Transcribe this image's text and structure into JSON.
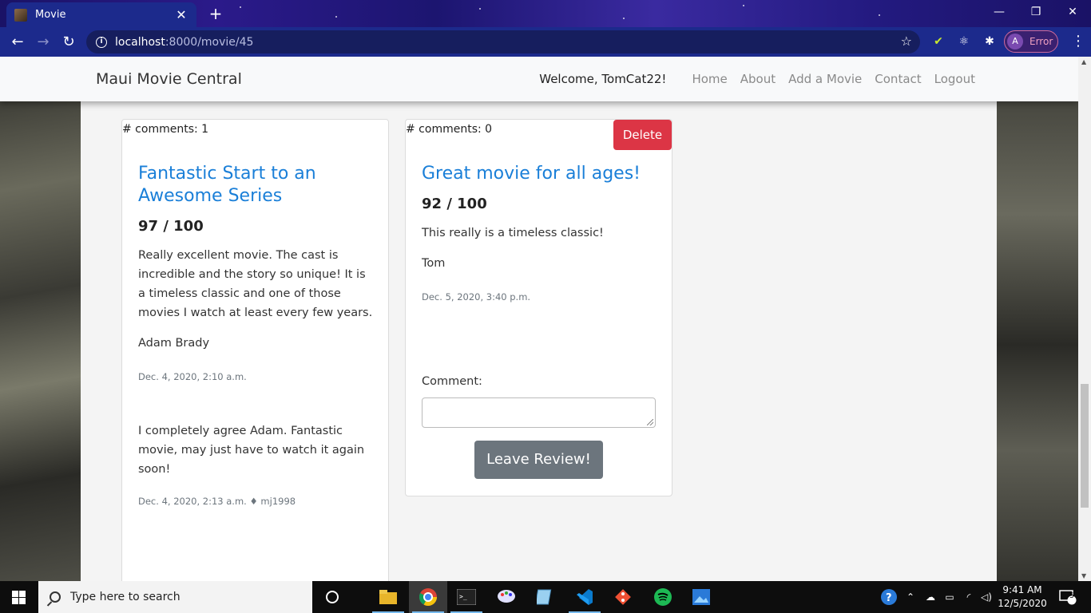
{
  "browser": {
    "tab_title": "Movie",
    "tab_close": "✕",
    "new_tab": "+",
    "url_host": "localhost",
    "url_path": ":8000/movie/45",
    "profile_initial": "A",
    "profile_status": "Error",
    "window_controls": [
      "—",
      "❐",
      "✕"
    ]
  },
  "navbar": {
    "brand": "Maui Movie Central",
    "welcome": "Welcome, TomCat22!",
    "links": [
      "Home",
      "About",
      "Add a Movie",
      "Contact",
      "Logout"
    ]
  },
  "reviews": [
    {
      "comments_count": "# comments: 1",
      "title": "Fantastic Start to an Awesome Series",
      "score": "97 / 100",
      "body": "Really excellent movie. The cast is incredible and the story so unique! It is a timeless classic and one of those movies I watch at least every few years.",
      "author": "Adam Brady",
      "date": "Dec. 4, 2020, 2:10 a.m.",
      "comment": {
        "text": "I completely agree Adam. Fantastic movie, may just have to watch it again soon!",
        "meta": "Dec. 4, 2020, 2:13 a.m. ♦ mj1998"
      }
    },
    {
      "comments_count": "# comments: 0",
      "delete_label": "Delete",
      "title": "Great movie for all ages!",
      "score": "92 / 100",
      "body": "This really is a timeless classic!",
      "author": "Tom",
      "date": "Dec. 5, 2020, 3:40 p.m.",
      "comment_label": "Comment:",
      "comment_value": "",
      "submit_label": "Leave Review!"
    }
  ],
  "taskbar": {
    "search_placeholder": "Type here to search",
    "apps": [
      "cortana-icon",
      "file-explorer-icon",
      "chrome-icon",
      "terminal-icon",
      "paint-icon",
      "notepad-icon",
      "vscode-icon",
      "git-icon",
      "spotify-icon",
      "photos-icon"
    ],
    "time": "9:41 AM",
    "date": "12/5/2020",
    "notification_count": "5"
  },
  "colors": {
    "link_blue": "#1a7fd8",
    "delete_red": "#dc3545",
    "button_gray": "#6c757d",
    "browser_frame": "#1c2a8c"
  }
}
